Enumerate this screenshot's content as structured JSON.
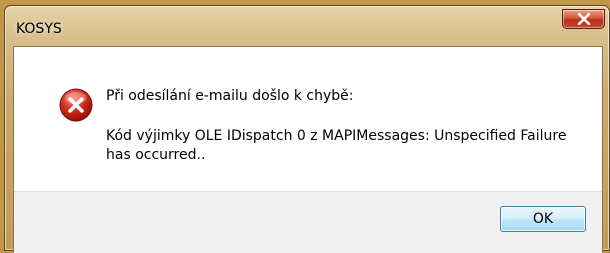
{
  "window": {
    "title": "KOSYS"
  },
  "dialog": {
    "icon": "error-icon",
    "heading": "Při odesílání e-mailu došlo k chybě:",
    "message": "Kód výjimky OLE IDispatch 0 z MAPIMessages: Unspecified Failure has occurred.."
  },
  "buttons": {
    "ok_label": "OK"
  },
  "colors": {
    "frame": "#c2964a",
    "close_button": "#c6452a",
    "error_icon": "#d42a1e",
    "ok_button_border": "#3c7fb1",
    "footer_bg": "#f0f0f0"
  }
}
